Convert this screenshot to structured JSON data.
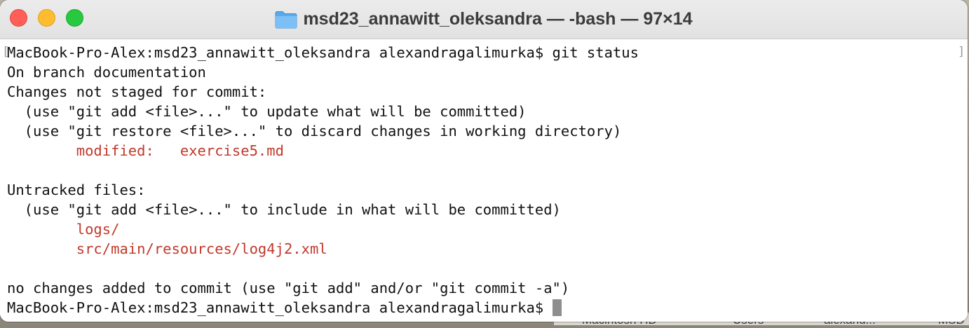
{
  "window": {
    "title": "msd23_annawitt_oleksandra — -bash — 97×14",
    "folder_icon": "folder-icon",
    "controls": {
      "close": "close-icon",
      "minimize": "minimize-icon",
      "zoom": "zoom-icon"
    }
  },
  "colors": {
    "text": "#111111",
    "status_red": "#c0392b",
    "cursor": "#8e8e8e",
    "close": "#ff5f57",
    "minimize": "#febc2e",
    "zoom": "#28c840"
  },
  "terminal": {
    "lines": [
      {
        "text": "MacBook-Pro-Alex:msd23_annawitt_oleksandra alexandragalimurka$ git status",
        "color": "default"
      },
      {
        "text": "On branch documentation",
        "color": "default"
      },
      {
        "text": "Changes not staged for commit:",
        "color": "default"
      },
      {
        "text": "  (use \"git add <file>...\" to update what will be committed)",
        "color": "default"
      },
      {
        "text": "  (use \"git restore <file>...\" to discard changes in working directory)",
        "color": "default"
      },
      {
        "text": "        modified:   exercise5.md",
        "color": "red"
      },
      {
        "text": "",
        "color": "default"
      },
      {
        "text": "Untracked files:",
        "color": "default"
      },
      {
        "text": "  (use \"git add <file>...\" to include in what will be committed)",
        "color": "default"
      },
      {
        "text": "        logs/",
        "color": "red"
      },
      {
        "text": "        src/main/resources/log4j2.xml",
        "color": "red"
      },
      {
        "text": "",
        "color": "default"
      },
      {
        "text": "no changes added to commit (use \"git add\" and/or \"git commit -a\")",
        "color": "default"
      }
    ],
    "prompt": "MacBook-Pro-Alex:msd23_annawitt_oleksandra alexandragalimurka$ ",
    "scroll_markers": {
      "left": "[",
      "right": "]"
    }
  },
  "background_finder_path": [
    "Macintosh HD",
    "Users",
    "alexand...",
    "MSD"
  ]
}
